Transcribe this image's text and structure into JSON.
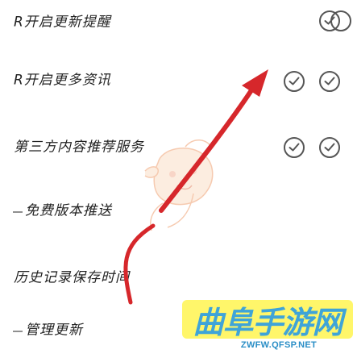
{
  "settings": {
    "rows": [
      {
        "label": "R开启更新提醒",
        "toggle": "off"
      },
      {
        "label": "R开启更多资讯",
        "toggle": "off"
      },
      {
        "label": "第三方内容推荐服务",
        "toggle": "off"
      },
      {
        "label": "免费版本推送",
        "toggle": "off"
      },
      {
        "label": "历史记录保存时间",
        "toggle": null
      },
      {
        "label": "管理更新",
        "toggle": null
      }
    ],
    "extra_toggles": [
      "off"
    ]
  },
  "watermark": {
    "title": "曲阜手游网",
    "url": "ZWFW.QFSP.NET"
  },
  "colors": {
    "arrow": "#d6272b",
    "toggle_border": "#555555",
    "watermark_bg": "#fff66a",
    "watermark_text": "#3fa4d8"
  },
  "icons": {
    "toggle_check": "check-circle-icon",
    "arrow": "red-arrow-annotation",
    "mascot": "mascot-face-icon"
  }
}
